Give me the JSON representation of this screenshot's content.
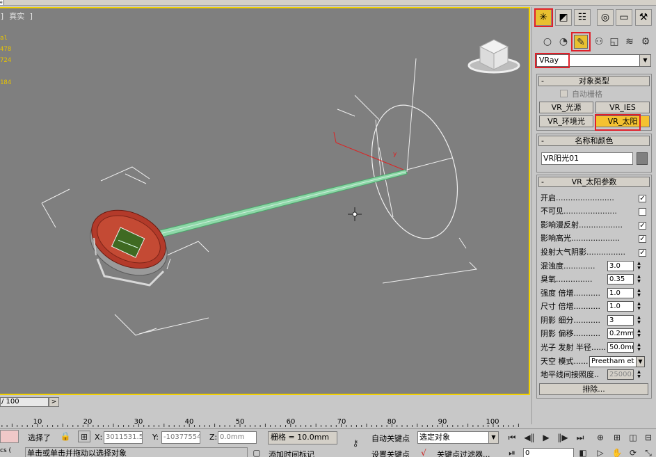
{
  "viewport": {
    "label": "] 真实 ]",
    "stats": [
      "al",
      "478",
      "724",
      "",
      "184"
    ]
  },
  "timeslider": {
    "range": "/ 100",
    "next": ">"
  },
  "ruler": {
    "labels": [
      "10",
      "20",
      "30",
      "40",
      "50",
      "60",
      "70",
      "80",
      "90",
      "100"
    ]
  },
  "panel": {
    "category": "VRay",
    "rollout_object_type": {
      "title": "对象类型",
      "autogrid": "自动栅格",
      "buttons": [
        "VR_光源",
        "VR_IES",
        "VR_环境光",
        "VR_太阳"
      ]
    },
    "rollout_name_color": {
      "title": "名称和颜色",
      "name": "VR阳光01",
      "swatch": "#808080"
    },
    "rollout_sun_params": {
      "title": "VR_太阳参数",
      "checks": [
        {
          "label": "开启........................",
          "checked": "✓"
        },
        {
          "label": "不可见......................",
          "checked": ""
        },
        {
          "label": "影响漫反射..................",
          "checked": "✓"
        },
        {
          "label": "影响高光....................",
          "checked": "✓"
        },
        {
          "label": "投射大气阴影................",
          "checked": "✓"
        }
      ],
      "spinners": [
        {
          "label": "混浊度.............",
          "value": "3.0"
        },
        {
          "label": "臭氧...............",
          "value": "0.35"
        },
        {
          "label": "强度 倍增...........",
          "value": "1.0"
        },
        {
          "label": "尺寸 倍增...........",
          "value": "1.0"
        },
        {
          "label": "阴影 细分...........",
          "value": "3"
        },
        {
          "label": "阴影 偏移...........",
          "value": "0.2mm"
        },
        {
          "label": "光子 发射 半径......",
          "value": "50.0mr"
        }
      ],
      "sky_model_label": "天空 模式......",
      "sky_model": "Preetham et",
      "horizon_label": "地平线间接照度..",
      "horizon_value": "25000.",
      "exclude": "排除..."
    }
  },
  "bottombar": {
    "left_tab": "cs (",
    "selected": "选择了",
    "status": "单击或单击并拖动以选择对象",
    "x_label": "X:",
    "x_value": "3011531.5",
    "y_label": "Y:",
    "y_value": "-10377554",
    "z_label": "Z:",
    "z_value": "0.0mm",
    "grid": "栅格 = 10.0mm",
    "add_time_tag": "添加时间标记",
    "auto_key": "自动关键点",
    "set_key": "设置关键点",
    "selection_set": "选定对象",
    "key_filters": "关键点过滤器...",
    "frame": "0"
  },
  "colors": {
    "viewport_border": "#f2d100",
    "highlight": "#e0202a",
    "active": "#f5c230"
  }
}
